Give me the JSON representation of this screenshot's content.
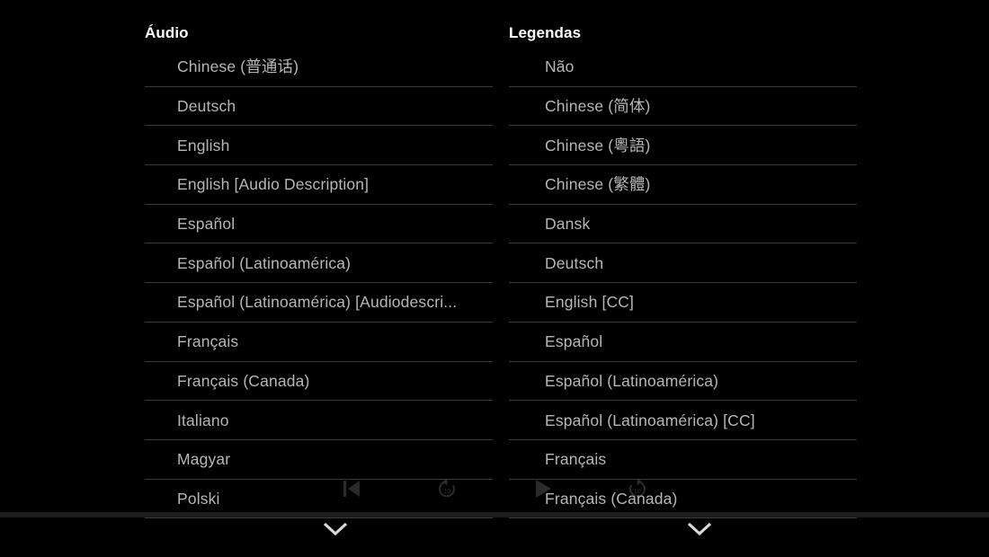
{
  "screen": {
    "background_color": "#000000",
    "divider_color": "#3a3a3a",
    "item_text_color": "#b6b6b6",
    "title_text_color": "#ffffff",
    "bottom_bar_color": "#1d1d1d"
  },
  "audio": {
    "title": "Áudio",
    "items": [
      {
        "label": "Chinese (普通话)"
      },
      {
        "label": "Deutsch"
      },
      {
        "label": "English"
      },
      {
        "label": "English [Audio Description]"
      },
      {
        "label": "Español"
      },
      {
        "label": "Español (Latinoamérica)"
      },
      {
        "label": "Español (Latinoamérica) [Audiodescri..."
      },
      {
        "label": "Français"
      },
      {
        "label": "Français (Canada)"
      },
      {
        "label": "Italiano"
      },
      {
        "label": "Magyar"
      },
      {
        "label": "Polski"
      }
    ]
  },
  "subtitles": {
    "title": "Legendas",
    "items": [
      {
        "label": "Não"
      },
      {
        "label": "Chinese (简体)"
      },
      {
        "label": "Chinese (粵語)"
      },
      {
        "label": "Chinese (繁體)"
      },
      {
        "label": "Dansk"
      },
      {
        "label": "Deutsch"
      },
      {
        "label": "English [CC]"
      },
      {
        "label": "Español"
      },
      {
        "label": "Español (Latinoamérica)"
      },
      {
        "label": "Español (Latinoamérica) [CC]"
      },
      {
        "label": "Français"
      },
      {
        "label": "Français (Canada)"
      }
    ]
  },
  "player_controls": {
    "previous": {
      "icon": "previous-track-icon",
      "label": ""
    },
    "rewind": {
      "icon": "rewind-10-icon",
      "label": "10"
    },
    "play": {
      "icon": "play-icon",
      "label": ""
    },
    "forward": {
      "icon": "forward-10-icon",
      "label": "10"
    }
  },
  "scroll_indicators": {
    "audio": {
      "icon": "chevron-down-icon"
    },
    "subtitles": {
      "icon": "chevron-down-icon"
    }
  }
}
